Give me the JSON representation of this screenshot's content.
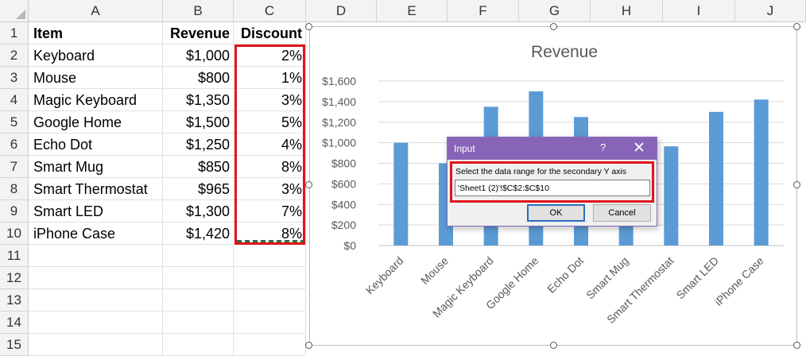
{
  "columns": [
    "A",
    "B",
    "C",
    "D",
    "E",
    "F",
    "G",
    "H",
    "I",
    "J"
  ],
  "rows": [
    "1",
    "2",
    "3",
    "4",
    "5",
    "6",
    "7",
    "8",
    "9",
    "10",
    "11",
    "12",
    "13",
    "14",
    "15"
  ],
  "table": {
    "headers": [
      "Item",
      "Revenue",
      "Discount"
    ],
    "data": [
      [
        "Keyboard",
        "$1,000",
        "2%"
      ],
      [
        "Mouse",
        "$800",
        "1%"
      ],
      [
        "Magic Keyboard",
        "$1,350",
        "3%"
      ],
      [
        "Google Home",
        "$1,500",
        "5%"
      ],
      [
        "Echo Dot",
        "$1,250",
        "4%"
      ],
      [
        "Smart Mug",
        "$850",
        "8%"
      ],
      [
        "Smart Thermostat",
        "$965",
        "3%"
      ],
      [
        "Smart LED",
        "$1,300",
        "7%"
      ],
      [
        "iPhone Case",
        "$1,420",
        "8%"
      ]
    ]
  },
  "chart_data": {
    "type": "bar",
    "title": "Revenue",
    "categories": [
      "Keyboard",
      "Mouse",
      "Magic Keyboard",
      "Google Home",
      "Echo Dot",
      "Smart Mug",
      "Smart Thermostat",
      "Smart LED",
      "iPhone Case"
    ],
    "values": [
      1000,
      800,
      1350,
      1500,
      1250,
      850,
      965,
      1300,
      1420
    ],
    "ylim": [
      0,
      1600
    ],
    "yticks": [
      "$0",
      "$200",
      "$400",
      "$600",
      "$800",
      "$1,000",
      "$1,200",
      "$1,400",
      "$1,600"
    ],
    "grid": true,
    "bar_color": "#5b9bd5"
  },
  "dialog": {
    "title": "Input",
    "help_label": "?",
    "close_label": "✕",
    "prompt": "Select the data range for the secondary Y axis",
    "value": "'Sheet1 (2)'!$C$2:$C$10",
    "ok_label": "OK",
    "cancel_label": "Cancel"
  },
  "colors": {
    "accent_red": "#e0141a",
    "dialog_title": "#8764b8",
    "bar": "#5b9bd5"
  }
}
